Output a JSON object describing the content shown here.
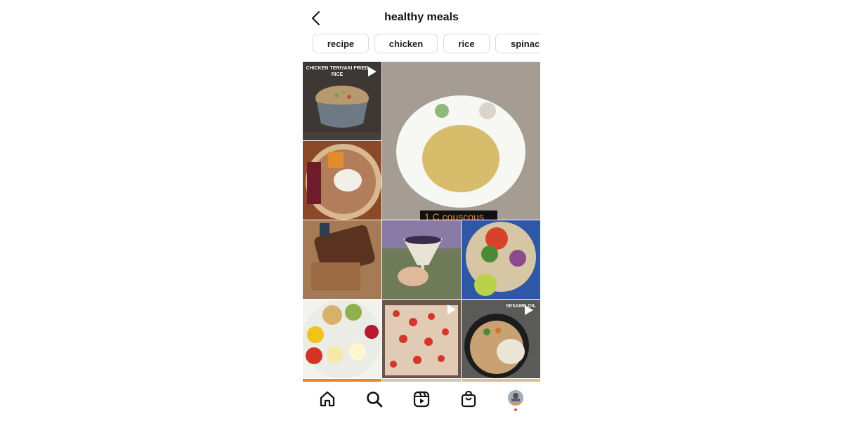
{
  "header": {
    "title": "healthy meals",
    "back_icon": "chevron-left-icon"
  },
  "chips": [
    {
      "label": "recipe"
    },
    {
      "label": "chicken"
    },
    {
      "label": "rice"
    },
    {
      "label": "spinach"
    }
  ],
  "grid": {
    "tiles": [
      {
        "name": "chicken-teriyaki-fried-rice",
        "overlay": "CHICKEN TERIYAKI FRIED RICE",
        "is_video": true
      },
      {
        "name": "couscous-bowl",
        "caption": "1 C couscous",
        "is_video": false
      },
      {
        "name": "oatmeal-bowl-fruit",
        "is_video": false
      },
      {
        "name": "banana-bread",
        "is_video": false
      },
      {
        "name": "parfait-glass",
        "is_video": false
      },
      {
        "name": "taco-salad-plate",
        "is_video": false
      },
      {
        "name": "chickpea-egg-salad",
        "is_video": false
      },
      {
        "name": "sheet-pan-breakfast",
        "is_video": true
      },
      {
        "name": "sesame-oil-stir-fry",
        "overlay": "SESAME OIL",
        "is_video": true
      }
    ]
  },
  "bottom_nav": {
    "items": [
      {
        "name": "home",
        "icon": "home-icon"
      },
      {
        "name": "search",
        "icon": "search-icon"
      },
      {
        "name": "reels",
        "icon": "reels-icon"
      },
      {
        "name": "shop",
        "icon": "shopping-bag-icon"
      },
      {
        "name": "profile",
        "icon": "avatar"
      }
    ],
    "notification_color": "#ed4956"
  }
}
